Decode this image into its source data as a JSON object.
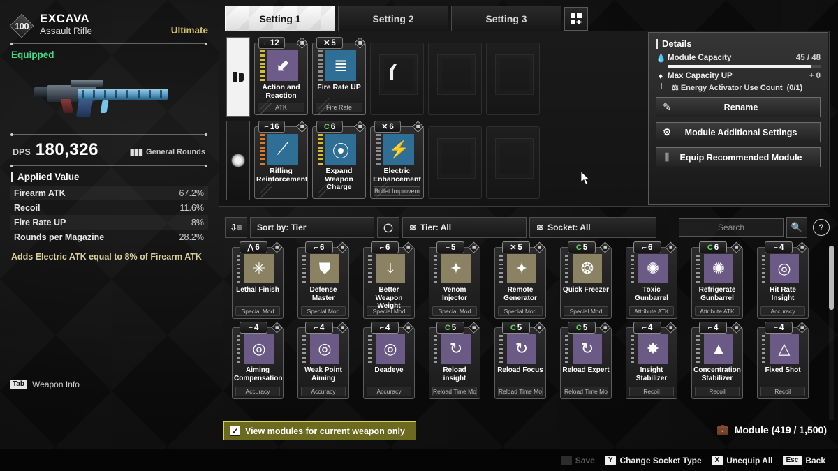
{
  "weapon": {
    "level": "100",
    "name": "EXCAVA",
    "type": "Assault Rifle",
    "rarity": "Ultimate",
    "status": "Equipped",
    "dps_label": "DPS",
    "dps_value": "180,326",
    "ammo_type": "General Rounds",
    "ammo_icon": "bullets-icon"
  },
  "applied_value": {
    "title": "Applied Value",
    "rows": [
      {
        "label": "Firearm ATK",
        "value": "67.2%"
      },
      {
        "label": "Recoil",
        "value": "11.6%"
      },
      {
        "label": "Fire Rate UP",
        "value": "8%"
      },
      {
        "label": "Rounds per Magazine",
        "value": "28.2%"
      }
    ],
    "description": "Adds Electric ATK equal to 8% of Firearm ATK"
  },
  "weapon_info_hint": {
    "key": "Tab",
    "label": "Weapon Info"
  },
  "tabs": [
    {
      "label": "Setting 1",
      "active": true
    },
    {
      "label": "Setting 2",
      "active": false
    },
    {
      "label": "Setting 3",
      "active": false
    }
  ],
  "tab_add_icon": "add-preset-icon",
  "equipped": {
    "rows": [
      {
        "row_icon": "weapon-slot-icon",
        "row_active": true,
        "slots": [
          {
            "filled": true,
            "capacity": "12",
            "socket_glyph": "cerulean-socket",
            "socket_badge_icon": "malachite-socket-icon",
            "name": "Action and Reaction",
            "type": "ATK",
            "icon": "arrow-down-up-icon",
            "icon_tint": "#6d5b8a",
            "energy_color": "yellow",
            "energy_bars": 8
          },
          {
            "filled": true,
            "capacity": "5",
            "socket_glyph": "xantic-socket",
            "socket_badge_icon": "malachite-socket-icon",
            "name": "Fire Rate UP",
            "type": "Fire Rate",
            "icon": "bullets-stack-icon",
            "icon_tint": "#2f6f96",
            "energy_color": "gray",
            "energy_bars": 8
          },
          {
            "filled": false,
            "glyph": true
          },
          {
            "filled": false,
            "glyph": false
          },
          {
            "filled": false,
            "glyph": false
          }
        ]
      },
      {
        "row_icon": "module-slot-icon",
        "row_active": false,
        "slots": [
          {
            "filled": true,
            "capacity": "16",
            "socket_glyph": "cerulean-socket",
            "socket_badge_icon": "malachite-socket-icon",
            "name": "Rifling Reinforcement",
            "type": "",
            "icon": "rifling-icon",
            "icon_tint": "#2f6f96",
            "energy_color": "orange",
            "energy_bars": 8
          },
          {
            "filled": true,
            "capacity": "6",
            "socket_glyph": "rutile-socket",
            "socket_badge_icon": "malachite-socket-icon",
            "name": "Expand Weapon Charge",
            "type": "",
            "icon": "cylinder-icon",
            "icon_tint": "#2f6f96",
            "energy_color": "yellow",
            "energy_bars": 8
          },
          {
            "filled": true,
            "capacity": "6",
            "socket_glyph": "xantic-socket",
            "socket_badge_icon": "malachite-socket-icon",
            "name": "Electric Enhancement",
            "type": "Bullet Improvem",
            "icon": "electric-bolt-icon",
            "icon_tint": "#2f6f96",
            "energy_color": "gray",
            "energy_bars": 8
          },
          {
            "filled": false,
            "glyph": false
          },
          {
            "filled": false,
            "glyph": false
          }
        ]
      }
    ]
  },
  "details": {
    "title": "Details",
    "module_capacity": {
      "icon": "droplet-icon",
      "label": "Module Capacity",
      "value": "45 / 48",
      "percent": 93.75
    },
    "max_capacity_up": {
      "icon": "droplet-up-icon",
      "label": "Max Capacity UP",
      "value": "+ 0"
    },
    "energy_activator": {
      "icon": "activator-icon",
      "label": "Energy Activator Use Count",
      "value": "(0/1)"
    },
    "buttons": [
      {
        "label": "Rename",
        "icon": "pencil-edit-icon"
      },
      {
        "label": "Module Additional Settings",
        "icon": "module-settings-icon"
      },
      {
        "label": "Equip Recommended Module",
        "icon": "recommend-bars-icon"
      }
    ]
  },
  "filters": {
    "sort_icon": "sort-desc-icon",
    "sort_label": "Sort by: Tier",
    "reset_icon": "reset-circle-icon",
    "tier_icon": "layers-icon",
    "tier_label": "Tier: All",
    "socket_icon": "layers-icon",
    "socket_label": "Socket: All",
    "search_placeholder": "Search",
    "search_value": "",
    "search_icon": "search-icon",
    "help_icon": "help-icon"
  },
  "grid": {
    "modules": [
      {
        "capacity": "6",
        "socket_glyph": "almandine-socket",
        "name": "Lethal Finish",
        "type": "Special Mod",
        "icon": "star-burst-icon",
        "tint": "#8b8263"
      },
      {
        "capacity": "6",
        "socket_glyph": "cerulean-socket",
        "name": "Defense Master",
        "type": "Special Mod",
        "icon": "shield-icon",
        "tint": "#8b8263"
      },
      {
        "capacity": "6",
        "socket_glyph": "cerulean-socket",
        "name": "Better Weapon Weight",
        "type": "Special Mod",
        "icon": "down-arrows-icon",
        "tint": "#8b8263"
      },
      {
        "capacity": "5",
        "socket_glyph": "cerulean-socket",
        "name": "Venom Injector",
        "type": "Special Mod",
        "icon": "venom-shard-icon",
        "tint": "#8b8263"
      },
      {
        "capacity": "5",
        "socket_glyph": "xantic-socket",
        "name": "Remote Generator",
        "type": "Special Mod",
        "icon": "venom-shard-icon",
        "tint": "#8b8263"
      },
      {
        "capacity": "5",
        "socket_glyph": "rutile-socket",
        "name": "Quick Freezer",
        "type": "Special Mod",
        "icon": "snowflake-dial-icon",
        "tint": "#8b8263"
      },
      {
        "capacity": "6",
        "socket_glyph": "cerulean-socket",
        "name": "Toxic Gunbarrel",
        "type": "Attribute ATK",
        "icon": "gunbarrel-burst-icon",
        "tint": "#6b5a86"
      },
      {
        "capacity": "6",
        "socket_glyph": "rutile-socket",
        "name": "Refrigerate Gunbarrel",
        "type": "Attribute ATK",
        "icon": "gunbarrel-burst-icon",
        "tint": "#6b5a86"
      },
      {
        "capacity": "4",
        "socket_glyph": "cerulean-socket",
        "name": "Hit Rate Insight",
        "type": "Accuracy",
        "icon": "crosshair-icon",
        "tint": "#6b5a86"
      },
      {
        "capacity": "4",
        "socket_glyph": "cerulean-socket",
        "name": "Aiming Compensation",
        "type": "Accuracy",
        "icon": "crosshair-icon",
        "tint": "#6b5a86"
      },
      {
        "capacity": "4",
        "socket_glyph": "cerulean-socket",
        "name": "Weak Point Aiming",
        "type": "Accuracy",
        "icon": "crosshair-icon",
        "tint": "#6b5a86"
      },
      {
        "capacity": "4",
        "socket_glyph": "cerulean-socket",
        "name": "Deadeye",
        "type": "Accuracy",
        "icon": "crosshair-icon",
        "tint": "#6b5a86"
      },
      {
        "capacity": "5",
        "socket_glyph": "rutile-socket",
        "name": "Reload insight",
        "type": "Reload Time Mo",
        "icon": "reload-icon",
        "tint": "#6b5a86"
      },
      {
        "capacity": "5",
        "socket_glyph": "rutile-socket",
        "name": "Reload Focus",
        "type": "Reload Time Mo",
        "icon": "reload-icon",
        "tint": "#6b5a86"
      },
      {
        "capacity": "5",
        "socket_glyph": "rutile-socket",
        "name": "Reload Expert",
        "type": "Reload Time Mo",
        "icon": "reload-icon",
        "tint": "#6b5a86"
      },
      {
        "capacity": "4",
        "socket_glyph": "cerulean-socket",
        "name": "Insight Stabilizer",
        "type": "Recoil",
        "icon": "star-spike-icon",
        "tint": "#6b5a86"
      },
      {
        "capacity": "4",
        "socket_glyph": "cerulean-socket",
        "name": "Concentration Stabilizer",
        "type": "Recoil",
        "icon": "triangle-up-icon",
        "tint": "#6b5a86"
      },
      {
        "capacity": "4",
        "socket_glyph": "cerulean-socket",
        "name": "Fixed Shot",
        "type": "Recoil",
        "icon": "triangle-outline-icon",
        "tint": "#6b5a86"
      }
    ]
  },
  "bottom": {
    "filter_checkbox": {
      "checked": true,
      "label": "View modules for current weapon only",
      "check_glyph": "✓"
    },
    "module_count_icon": "inventory-bag-icon",
    "module_count": "Module (419 / 1,500)"
  },
  "commands": [
    {
      "key": "",
      "label": "Save",
      "dim": true
    },
    {
      "key": "Y",
      "label": "Change Socket Type",
      "dim": false
    },
    {
      "key": "X",
      "label": "Unequip All",
      "dim": false
    },
    {
      "key": "Esc",
      "label": "Back",
      "dim": false
    }
  ],
  "colors": {
    "accent_gold": "#d6c26a",
    "equipped_green": "#3ddc84",
    "filter_yellow": "#6b6a1e",
    "filter_border": "#d8d255"
  }
}
